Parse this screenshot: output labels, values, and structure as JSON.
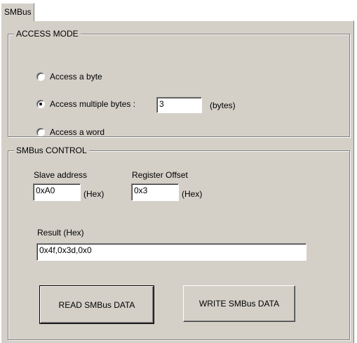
{
  "tab": {
    "label": "SMBus"
  },
  "access_mode": {
    "title": "ACCESS MODE",
    "options": [
      {
        "label": "Access a byte",
        "checked": false
      },
      {
        "label": "Access multiple bytes :",
        "checked": true
      },
      {
        "label": "Access a word",
        "checked": false
      }
    ],
    "byte_count": {
      "value": "3",
      "unit": "(bytes)"
    }
  },
  "control": {
    "title": "SMBus CONTROL",
    "slave_address": {
      "label": "Slave address",
      "value": "0xA0",
      "unit": "(Hex)"
    },
    "register_offset": {
      "label": "Register Offset",
      "value": "0x3",
      "unit": "(Hex)"
    },
    "result": {
      "label": "Result (Hex)",
      "value": "0x4f,0x3d,0x0"
    },
    "read_button": "READ SMBus DATA",
    "write_button": "WRITE SMBus DATA"
  }
}
